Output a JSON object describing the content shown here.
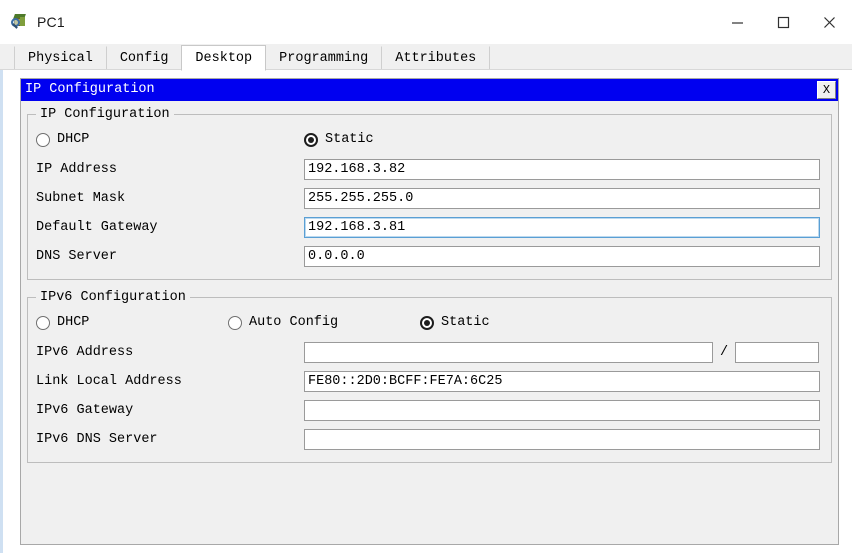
{
  "window": {
    "title": "PC1",
    "icon": "packet-tracer-pc-icon",
    "minimize_label": "—",
    "maximize_label": "□",
    "close_label": "✕"
  },
  "tabs": [
    {
      "label": "Physical",
      "active": false
    },
    {
      "label": "Config",
      "active": false
    },
    {
      "label": "Desktop",
      "active": true
    },
    {
      "label": "Programming",
      "active": false
    },
    {
      "label": "Attributes",
      "active": false
    }
  ],
  "subwindow": {
    "title": "IP Configuration",
    "close_label": "X",
    "titlebar_color": "#0000f0"
  },
  "ipv4": {
    "legend": "IP Configuration",
    "mode_dhcp_label": "DHCP",
    "mode_dhcp_selected": false,
    "mode_static_label": "Static",
    "mode_static_selected": true,
    "fields": [
      {
        "label": "IP Address",
        "value": "192.168.3.82",
        "focused": false
      },
      {
        "label": "Subnet Mask",
        "value": "255.255.255.0",
        "focused": false
      },
      {
        "label": "Default Gateway",
        "value": "192.168.3.81",
        "focused": true
      },
      {
        "label": "DNS Server",
        "value": "0.0.0.0",
        "focused": false
      }
    ]
  },
  "ipv6": {
    "legend": "IPv6 Configuration",
    "mode_dhcp_label": "DHCP",
    "mode_dhcp_selected": false,
    "mode_auto_label": "Auto Config",
    "mode_auto_selected": false,
    "mode_static_label": "Static",
    "mode_static_selected": true,
    "address_label": "IPv6 Address",
    "address_value": "",
    "prefix_separator": "/",
    "prefix_value": "",
    "link_local_label": "Link Local Address",
    "link_local_value": "FE80::2D0:BCFF:FE7A:6C25",
    "gateway_label": "IPv6 Gateway",
    "gateway_value": "",
    "dns_label": "IPv6 DNS Server",
    "dns_value": ""
  }
}
